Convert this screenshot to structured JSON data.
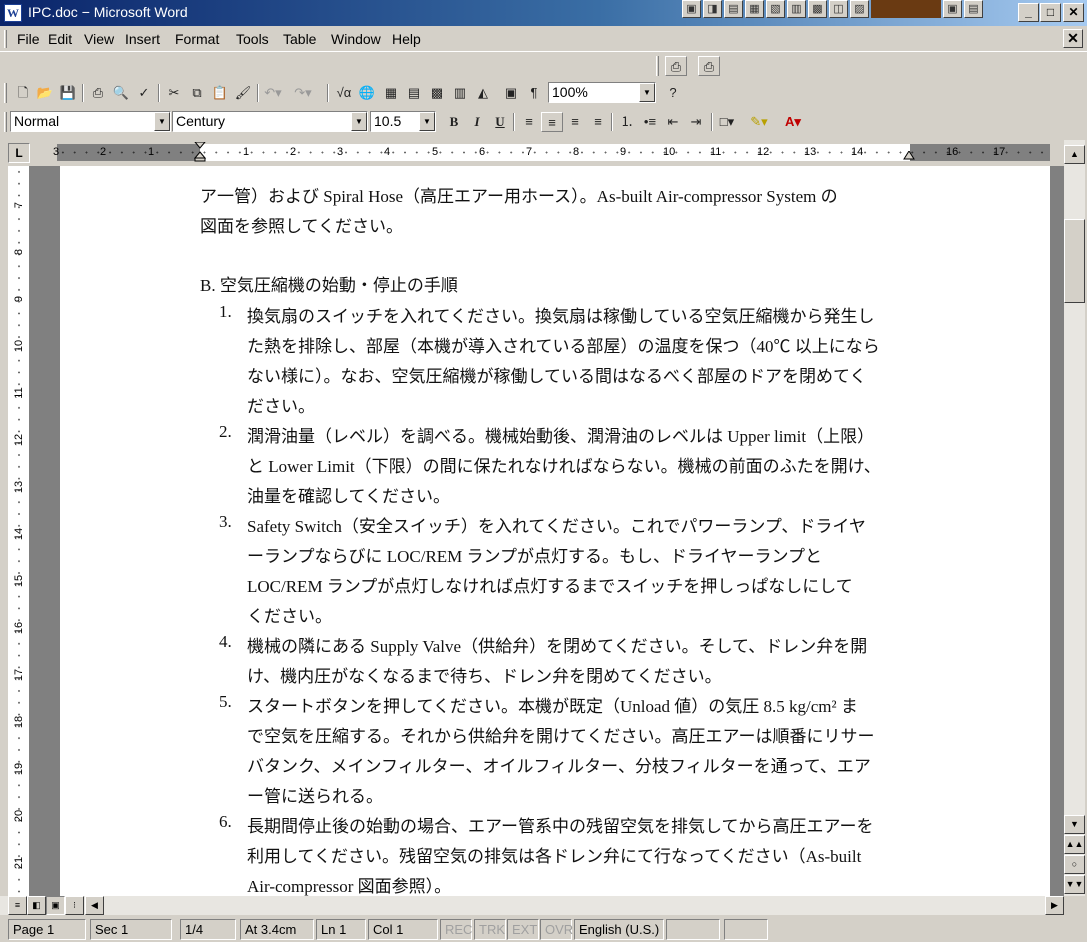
{
  "window": {
    "title": "IPC.doc − Microsoft Word",
    "app_icon_letter": "W",
    "controls": {
      "minimize": "_",
      "maximize": "□",
      "close": "✕"
    }
  },
  "menu": {
    "items": [
      "File",
      "Edit",
      "View",
      "Insert",
      "Format",
      "Tools",
      "Table",
      "Window",
      "Help"
    ],
    "doc_close": "✕"
  },
  "toolbar": {
    "zoom": "100%"
  },
  "format_toolbar": {
    "style": "Normal",
    "font": "Century",
    "size": "10.5",
    "bold": "B",
    "italic": "I",
    "underline": "U"
  },
  "ruler": {
    "tab_selector": "L",
    "ticks": [
      "3",
      "2",
      "1",
      "1",
      "2",
      "3",
      "4",
      "5",
      "6",
      "7",
      "8",
      "9",
      "10",
      "11",
      "12",
      "13",
      "14",
      "16",
      "17"
    ]
  },
  "vertical_ruler": {
    "ticks": [
      "7",
      "8",
      "9",
      "10",
      "11",
      "12",
      "13",
      "14",
      "15",
      "16",
      "17",
      "18",
      "19",
      "20",
      "21"
    ]
  },
  "document": {
    "lines": [
      "ア一管）および Spiral Hose（高圧エアー用ホース）。As-built Air-compressor System の",
      "図面を参照してください。",
      "B. 空気圧縮機の始動・停止の手順",
      "1.",
      "換気扇のスイッチを入れてください。換気扇は稼働している空気圧縮機から発生し",
      "た熱を排除し、部屋（本機が導入されている部屋）の温度を保つ（40℃ 以上になら",
      "ない様に）。なお、空気圧縮機が稼働している間はなるべく部屋のドアを閉めてく",
      "ださい。",
      "2.",
      "潤滑油量（レベル）を調べる。機械始動後、潤滑油のレベルは Upper limit（上限）",
      "と Lower Limit（下限）の間に保たれなければならない。機械の前面のふたを開け、",
      "油量を確認してください。",
      "3.",
      "Safety Switch（安全スイッチ）を入れてください。これでパワーランプ、ドライヤ",
      "ーランプならびに LOC/REM ランプが点灯する。もし、ドライヤーランプと",
      "LOC/REM ランプが点灯しなければ点灯するまでスイッチを押しっぱなしにして",
      "ください。",
      "4.",
      "機械の隣にある Supply Valve（供給弁）を閉めてください。そして、ドレン弁を開",
      "け、機内圧がなくなるまで待ち、ドレン弁を閉めてください。",
      "5.",
      "スタートボタンを押してください。本機が既定（Unload 値）の気圧 8.5 kg/cm² ま",
      "で空気を圧縮する。それから供給弁を開けてください。高圧エアーは順番にリサー",
      "バタンク、メインフィルター、オイルフィルター、分枝フィルターを通って、エア",
      "ー管に送られる。",
      "6.",
      "長期間停止後の始動の場合、エアー管系中の残留空気を排気してから高圧エアーを",
      "利用してください。残留空気の排気は各ドレン弁にて行なってください（As-built",
      "Air-compressor 図面参照）。"
    ]
  },
  "status": {
    "page": "Page 1",
    "sec": "Sec 1",
    "pages": "1/4",
    "at": "At 3.4cm",
    "ln": "Ln 1",
    "col": "Col 1",
    "rec": "REC",
    "trk": "TRK",
    "ext": "EXT",
    "ovr": "OVR",
    "language": "English (U.S.)"
  }
}
